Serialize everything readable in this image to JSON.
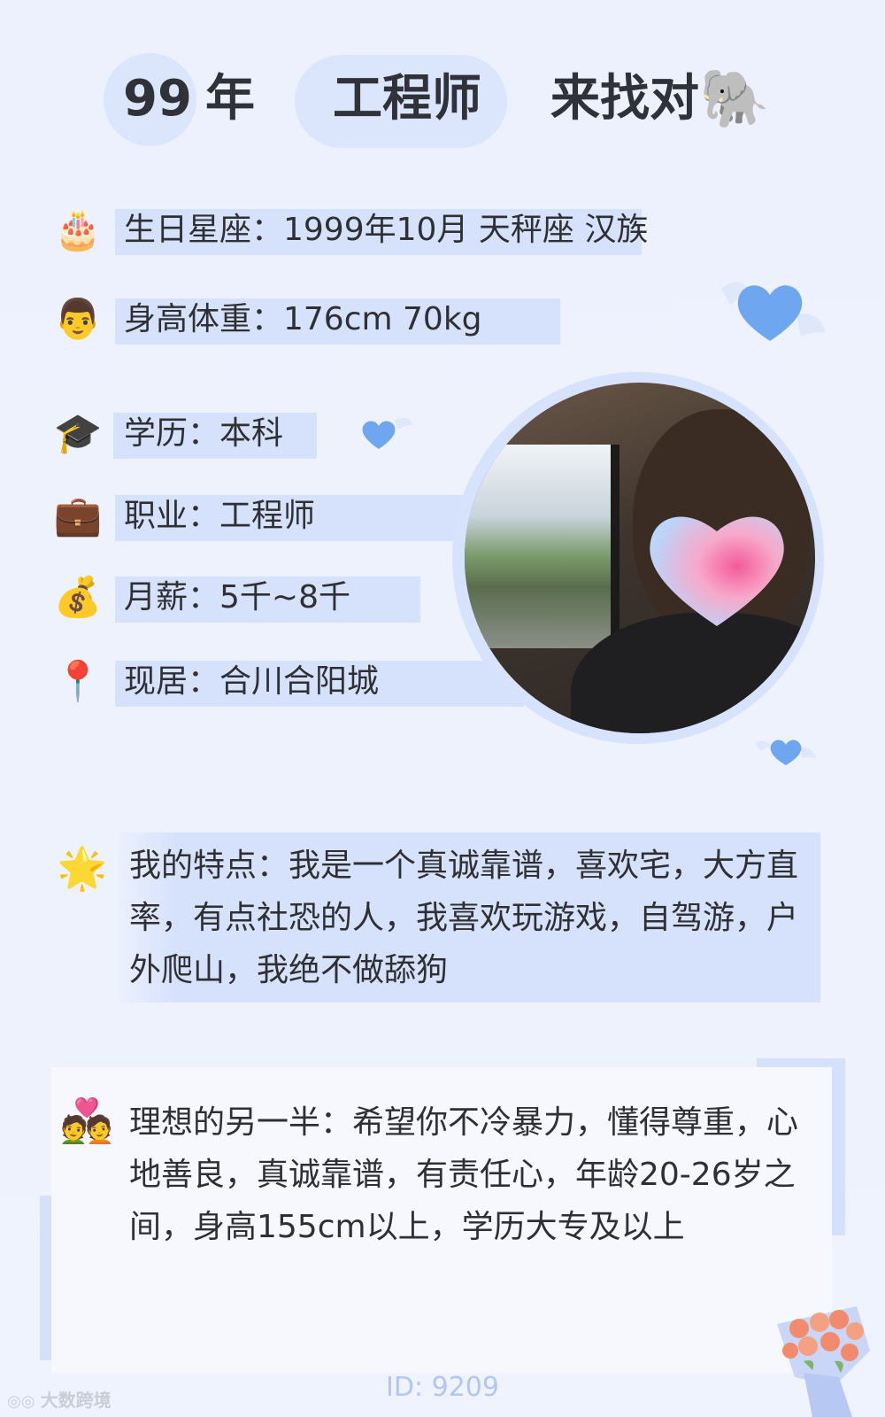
{
  "header": {
    "age": "99",
    "year_word": "年",
    "job": "工程师",
    "seeking": "来找对",
    "seeking_icon": "🐘",
    "seeking_icon_name": "elephant-icon"
  },
  "info": [
    {
      "icon": "🎂",
      "icon_name": "cake-icon",
      "text": "生日星座：1999年10月 天秤座 汉族"
    },
    {
      "icon": "👨",
      "icon_name": "man-face-icon",
      "text": "身高体重：176cm 70kg"
    },
    {
      "icon": "🎓",
      "icon_name": "graduation-cap-icon",
      "text": "学历：本科"
    },
    {
      "icon": "💼",
      "icon_name": "briefcase-icon",
      "text": "职业：工程师"
    },
    {
      "icon": "💰",
      "icon_name": "money-bag-icon",
      "text": "月薪：5千~8千"
    },
    {
      "icon": "📍",
      "icon_name": "location-pin-icon",
      "text": "现居：合川合阳城"
    }
  ],
  "features": {
    "icon": "🌟",
    "icon_name": "star-icon",
    "text": "我的特点：我是一个真诚靠谱，喜欢宅，大方直率，有点社恐的人，我喜欢玩游戏，自驾游，户外爬山，我绝不做舔狗"
  },
  "ideal": {
    "icon": "💑",
    "icon_name": "couple-heart-icon",
    "text": "理想的另一半：希望你不冷暴力，懂得尊重，心地善良，真诚靠谱，有责任心，年龄20-26岁之间，身高155cm以上，学历大专及以上"
  },
  "footer": {
    "id_text": "ID: 9209",
    "watermark": "大数跨境"
  },
  "colors": {
    "background": "#eef2fd",
    "highlight": "#d6e2fc",
    "heart": "#6fa6f0",
    "id_text": "#b3c6f3"
  }
}
